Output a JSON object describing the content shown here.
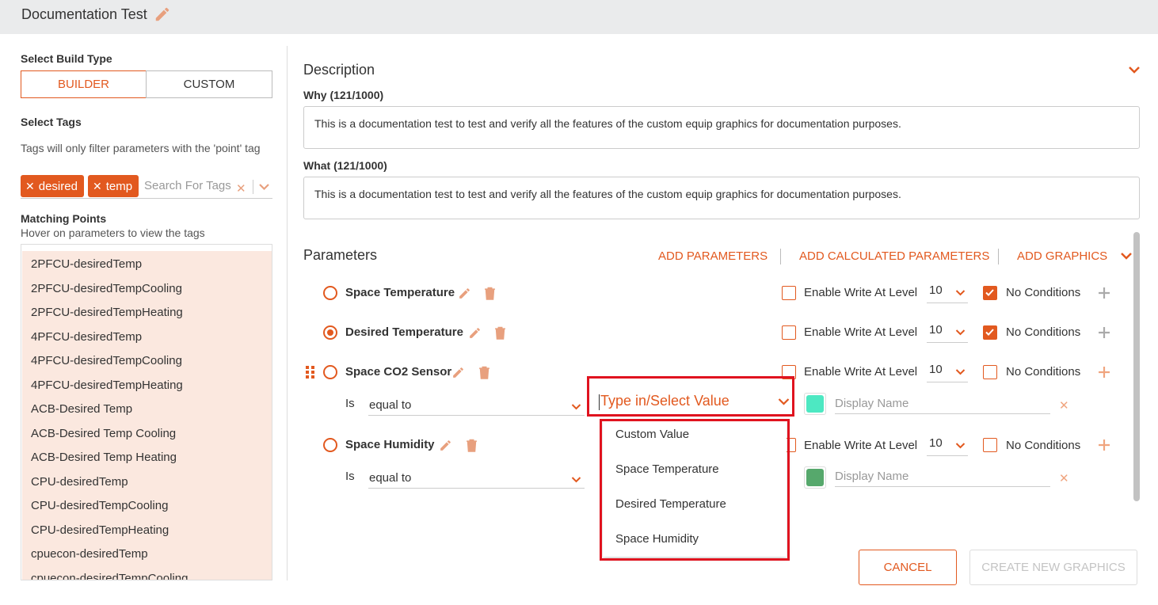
{
  "header": {
    "title": "Documentation Test"
  },
  "sidebar": {
    "build_type_label": "Select Build Type",
    "builder_label": "BUILDER",
    "custom_label": "CUSTOM",
    "tags_label": "Select Tags",
    "tags_hint": "Tags will only filter parameters with the 'point' tag",
    "tags": [
      "desired",
      "temp"
    ],
    "tag_search_placeholder": "Search For Tags",
    "matching_title": "Matching Points",
    "matching_hint": "Hover on parameters to view the tags",
    "points": [
      "2PFCU-desiredTemp",
      "2PFCU-desiredTempCooling",
      "2PFCU-desiredTempHeating",
      "4PFCU-desiredTemp",
      "4PFCU-desiredTempCooling",
      "4PFCU-desiredTempHeating",
      "ACB-Desired Temp",
      "ACB-Desired Temp Cooling",
      "ACB-Desired Temp Heating",
      "CPU-desiredTemp",
      "CPU-desiredTempCooling",
      "CPU-desiredTempHeating",
      "cpuecon-desiredTemp",
      "cpuecon-desiredTempCooling"
    ]
  },
  "description": {
    "title": "Description",
    "why_label": "Why (121/1000)",
    "why_text": "This is a documentation test to test and verify all the features of the custom equip graphics for documentation purposes.",
    "what_label": "What (121/1000)",
    "what_text": "This is a documentation test to test and verify all the features of the custom equip graphics for documentation purposes."
  },
  "parameters": {
    "title": "Parameters",
    "add_parameters": "ADD PARAMETERS",
    "add_calculated": "ADD CALCULATED PARAMETERS",
    "add_graphics": "ADD GRAPHICS",
    "enable_label": "Enable Write At Level",
    "no_conditions_label": "No Conditions",
    "is_label": "Is",
    "display_name_placeholder": "Display Name",
    "items": [
      {
        "name": "Space Temperature",
        "selected": false,
        "level": "10",
        "no_conditions": true
      },
      {
        "name": "Desired Temperature",
        "selected": true,
        "level": "10",
        "no_conditions": true
      },
      {
        "name": "Space CO2 Sensor",
        "selected": false,
        "level": "10",
        "no_conditions": false,
        "condition": {
          "operator": "equal to",
          "value_placeholder": "Type in/Select Value",
          "color": "#4de8c2"
        }
      },
      {
        "name": "Space Humidity",
        "selected": false,
        "level": "10",
        "no_conditions": false,
        "condition": {
          "operator": "equal to",
          "color": "#56a86c"
        }
      }
    ],
    "value_menu": [
      "Custom Value",
      "Space Temperature",
      "Desired Temperature",
      "Space Humidity"
    ]
  },
  "footer": {
    "cancel": "CANCEL",
    "create": "CREATE NEW GRAPHICS"
  },
  "colors": {
    "accent": "#e2591f",
    "highlight": "#e0131f",
    "point_bg": "#fbe8df"
  }
}
